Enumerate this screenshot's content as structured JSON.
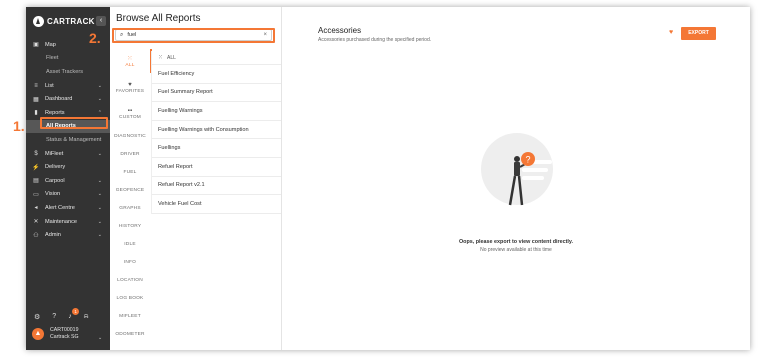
{
  "sidebar": {
    "brand": "CARTRACK",
    "collapse_glyph": "‹",
    "items": [
      {
        "label": "Map",
        "icon": "map-icon",
        "glyph": "▣",
        "type": "main"
      },
      {
        "label": "Fleet",
        "type": "sub"
      },
      {
        "label": "Asset Trackers",
        "type": "sub"
      },
      {
        "label": "List",
        "icon": "list-icon",
        "glyph": "≡",
        "type": "main",
        "chevron": "⌄"
      },
      {
        "label": "Dashboard",
        "icon": "dashboard-icon",
        "glyph": "▦",
        "type": "main",
        "chevron": "⌄"
      },
      {
        "label": "Reports",
        "icon": "reports-icon",
        "glyph": "▮",
        "type": "main",
        "chevron": "⌃"
      },
      {
        "label": "All Reports",
        "type": "sub",
        "active": true
      },
      {
        "label": "Status & Management",
        "type": "sub"
      },
      {
        "label": "MiFleet",
        "icon": "dollar-icon",
        "glyph": "$",
        "type": "main",
        "chevron": "⌄"
      },
      {
        "label": "Delivery",
        "icon": "delivery-icon",
        "glyph": "⚡",
        "type": "main"
      },
      {
        "label": "Carpool",
        "icon": "calendar-icon",
        "glyph": "▤",
        "type": "main",
        "chevron": "⌄"
      },
      {
        "label": "Vision",
        "icon": "camera-icon",
        "glyph": "▭",
        "type": "main",
        "chevron": "⌄"
      },
      {
        "label": "Alert Centre",
        "icon": "alert-icon",
        "glyph": "◂",
        "type": "main",
        "chevron": "⌄"
      },
      {
        "label": "Maintenance",
        "icon": "wrench-icon",
        "glyph": "✕",
        "type": "main",
        "chevron": "⌄"
      },
      {
        "label": "Admin",
        "icon": "admin-icon",
        "glyph": "⚇",
        "type": "main",
        "chevron": "⌄"
      }
    ],
    "footer": {
      "settings_glyph": "⚙",
      "help_glyph": "?",
      "notif_badge": "1",
      "bell_glyph": "♪",
      "user_name": "CART00019",
      "user_company": "Cartrack SG",
      "user_chevron": "⌄"
    }
  },
  "browse": {
    "title": "Browse All Reports",
    "search_value": "fuel",
    "search_glyph": "⌕",
    "clear_glyph": "×",
    "categories": [
      {
        "label": "ALL",
        "glyph": "⁙",
        "active": true
      },
      {
        "label": "FAVORITES",
        "glyph": "♥"
      },
      {
        "label": "CUSTOM",
        "glyph": "▪▪"
      },
      {
        "label": "DIAGNOSTIC"
      },
      {
        "label": "DRIVER"
      },
      {
        "label": "FUEL"
      },
      {
        "label": "GEOFENCE"
      },
      {
        "label": "GRAPHS"
      },
      {
        "label": "HISTORY"
      },
      {
        "label": "IDLE"
      },
      {
        "label": "INFO"
      },
      {
        "label": "LOCATION"
      },
      {
        "label": "LOG BOOK"
      },
      {
        "label": "MIFLEET"
      },
      {
        "label": "ODOMETER"
      }
    ],
    "reports_header": "ALL",
    "reports_header_glyph": "⁙",
    "reports": [
      "Fuel Efficiency",
      "Fuel Summary Report",
      "Fuelling Warnings",
      "Fuelling Warnings with Consumption",
      "Fuellings",
      "Refuel Report",
      "Refuel Report v2.1",
      "Vehicle Fuel Cost"
    ]
  },
  "main": {
    "title": "Accessories",
    "subtitle": "Accessories purchased during the specified period.",
    "favorite_glyph": "♥",
    "export_label": "EXPORT",
    "empty_title": "Oops, please export to view content directly.",
    "empty_sub": "No preview available at this time"
  },
  "callouts": {
    "one": "1.",
    "two": "2."
  },
  "colors": {
    "accent": "#f47735",
    "sidebar_bg": "#333333"
  }
}
